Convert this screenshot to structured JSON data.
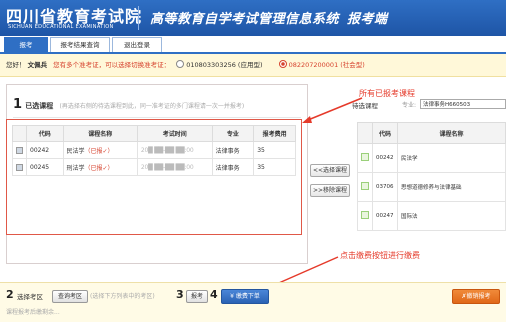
{
  "header": {
    "logo_main": "四川省教育考试院",
    "logo_sub": "SICHUAN EDUCATIONAL EXAMINATION",
    "system_title": "高等教育自学考试管理信息系统",
    "system_suffix": "报考端"
  },
  "tabs": [
    {
      "label": "报考"
    },
    {
      "label": "报考结果查询"
    },
    {
      "label": "退出登录"
    }
  ],
  "greeting": {
    "hello": "您好！",
    "name": "文佩兵",
    "note": "您有多个准考证，可以选择切换准考证：",
    "option1": "010803303256 (应用型)",
    "option2": "082207200001 (社会型)"
  },
  "selected_panel": {
    "number": "1",
    "label": "已选课程",
    "hint": "(再选择右侧的待选课程到此，同一准考证的多门课程请一次一并报考)",
    "columns": [
      "代码",
      "课程名称",
      "考试时间",
      "专业",
      "报考费用"
    ],
    "rows": [
      {
        "code": "00242",
        "name": "民法学",
        "status": "（已报✓）",
        "time": "20█ ██-██ ██:00",
        "major": "法律事务",
        "fee": "35"
      },
      {
        "code": "00245",
        "name": "刑法学",
        "status": "（已报✓）",
        "time": "20█ ██-██ ██:00",
        "major": "法律事务",
        "fee": "35"
      }
    ]
  },
  "mid_buttons": {
    "select": "<<选择课程",
    "remove": ">>移除课程"
  },
  "right_panel": {
    "label": "待选课程",
    "prof_label": "专业:",
    "major_select": "法律事务H660503",
    "columns": [
      "代码",
      "课程名称"
    ],
    "rows": [
      {
        "code": "00242",
        "name": "民法学"
      },
      {
        "code": "03706",
        "name": "思想道德修养与法律基础"
      },
      {
        "code": "00247",
        "name": "国际法"
      }
    ]
  },
  "annotations": {
    "top": "所有已报考课程",
    "bottom": "点击缴费按钮进行缴费"
  },
  "bottom": {
    "step2": "2",
    "step2_text": "选择考区",
    "query_button": "查询考区",
    "step2_hint": "(选择下方列表中的考区)",
    "step3": "3",
    "step3_button": "报考",
    "step4": "4",
    "pay_button": "¥ 缴费下单",
    "cancel_button": "✗撤销报考",
    "hint2": "课程报考后缴剩余..."
  }
}
